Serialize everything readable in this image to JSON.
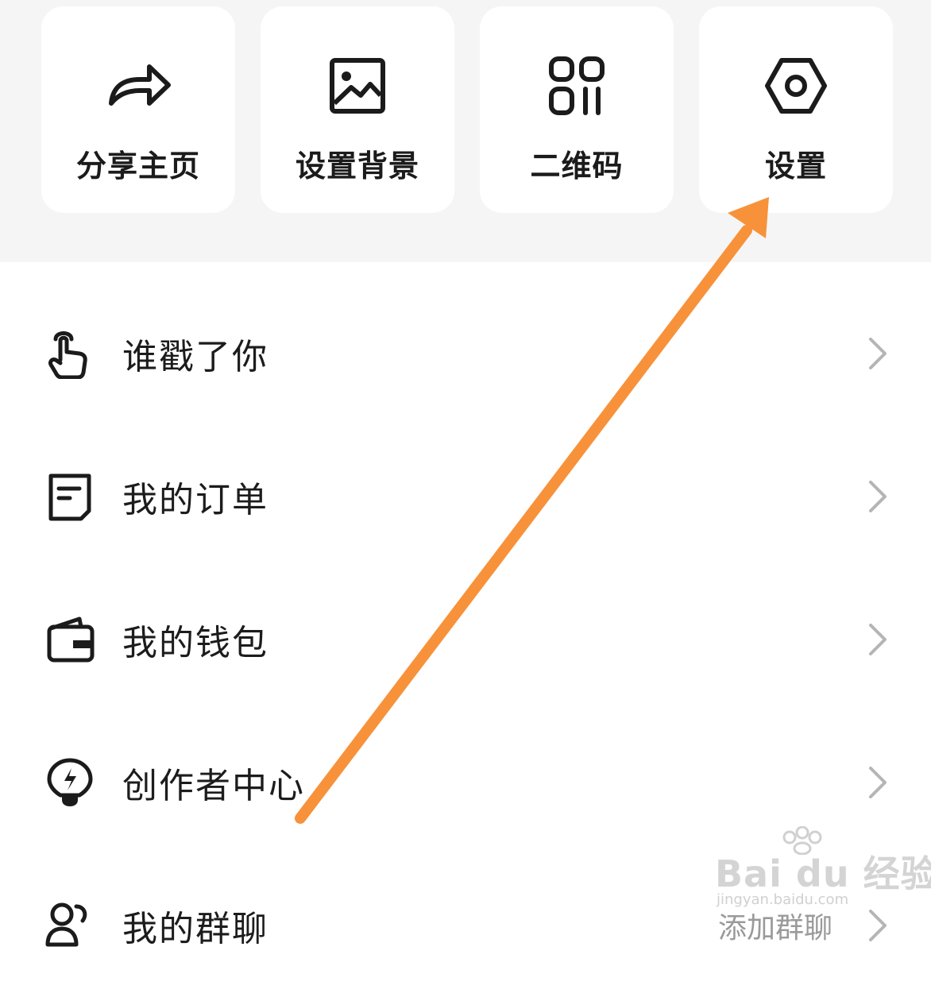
{
  "shortcuts": [
    {
      "label": "分享主页",
      "icon": "share-icon"
    },
    {
      "label": "设置背景",
      "icon": "image-icon"
    },
    {
      "label": "二维码",
      "icon": "qr-code-icon"
    },
    {
      "label": "设置",
      "icon": "settings-icon"
    }
  ],
  "menu": [
    {
      "label": "谁戳了你",
      "icon": "poke-hand-icon"
    },
    {
      "label": "我的订单",
      "icon": "order-icon"
    },
    {
      "label": "我的钱包",
      "icon": "wallet-icon"
    },
    {
      "label": "创作者中心",
      "icon": "creator-bulb-icon"
    },
    {
      "label": "我的群聊",
      "icon": "group-chat-icon",
      "trailing": "添加群聊"
    }
  ],
  "annotation": {
    "color": "#f7923a",
    "target": "设置"
  },
  "watermark": {
    "brand": "Bai du 经验",
    "url": "jingyan.baidu.com"
  },
  "colors": {
    "panel_bg": "#f5f5f5",
    "card_bg": "#ffffff",
    "chevron": "#b5b5b5"
  }
}
